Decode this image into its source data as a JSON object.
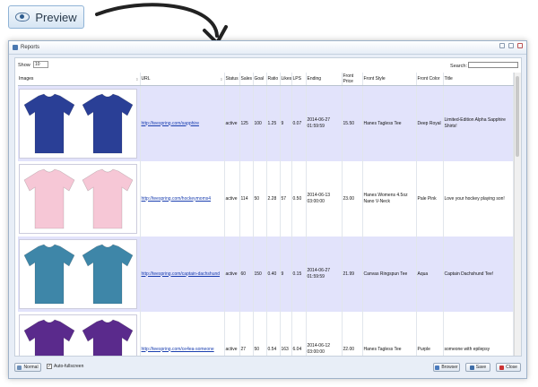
{
  "preview_button": {
    "label": "Preview"
  },
  "window": {
    "title": "Reports",
    "show_label": "Show",
    "show_value": "10",
    "search_label": "Search:",
    "columns": [
      "Images",
      "URL",
      "Status",
      "Sales",
      "Goal",
      "Ratio",
      "Likes",
      "LPS",
      "Ending",
      "Front Price",
      "Front Style",
      "Front Color",
      "Title"
    ],
    "rows": [
      {
        "url": "http://teespring.com/sapphire",
        "status": "active",
        "sales": "125",
        "goal": "100",
        "ratio": "1.25",
        "likes": "9",
        "lps": "0.07",
        "ending": "2014-06-27 01:59:59",
        "price": "15.50",
        "style": "Hanes Tagless Tee",
        "color": "Deep Royal",
        "title": "Limited-Edition Alpha Sapphire Shirts!"
      },
      {
        "url": "http://teespring.com/hockeymoms4",
        "status": "active",
        "sales": "114",
        "goal": "50",
        "ratio": "2.28",
        "likes": "57",
        "lps": "0.50",
        "ending": "2014-06-13 03:00:00",
        "price": "23.00",
        "style": "Hanes Womens 4.5oz Nano V-Neck",
        "color": "Pale Pink",
        "title": "Love your hockey playing son!"
      },
      {
        "url": "http://teespring.com/captain-dachshund",
        "status": "active",
        "sales": "60",
        "goal": "150",
        "ratio": "0.40",
        "likes": "9",
        "lps": "0.15",
        "ending": "2014-06-27 01:59:59",
        "price": "21.99",
        "style": "Canvas Ringspun Tee",
        "color": "Aqua",
        "title": "Captain Dachshund Tee!"
      },
      {
        "url": "http://teespring.com/ce4ea-someone",
        "status": "active",
        "sales": "27",
        "goal": "50",
        "ratio": "0.54",
        "likes": "163",
        "lps": "6.04",
        "ending": "2014-06-12 03:00:00",
        "price": "22.00",
        "style": "Hanes Tagless Tee",
        "color": "Purple",
        "title": "someone with epilepsy"
      }
    ],
    "shirt_colors": [
      "#2a3f96",
      "#f6c7d6",
      "#3e86a8",
      "#5a2a8c"
    ],
    "footer": {
      "normal_label": "Normal",
      "autofullscreen_label": "Auto-fullscreen",
      "browser_label": "Browser",
      "save_label": "Save",
      "close_label": "Close"
    }
  }
}
